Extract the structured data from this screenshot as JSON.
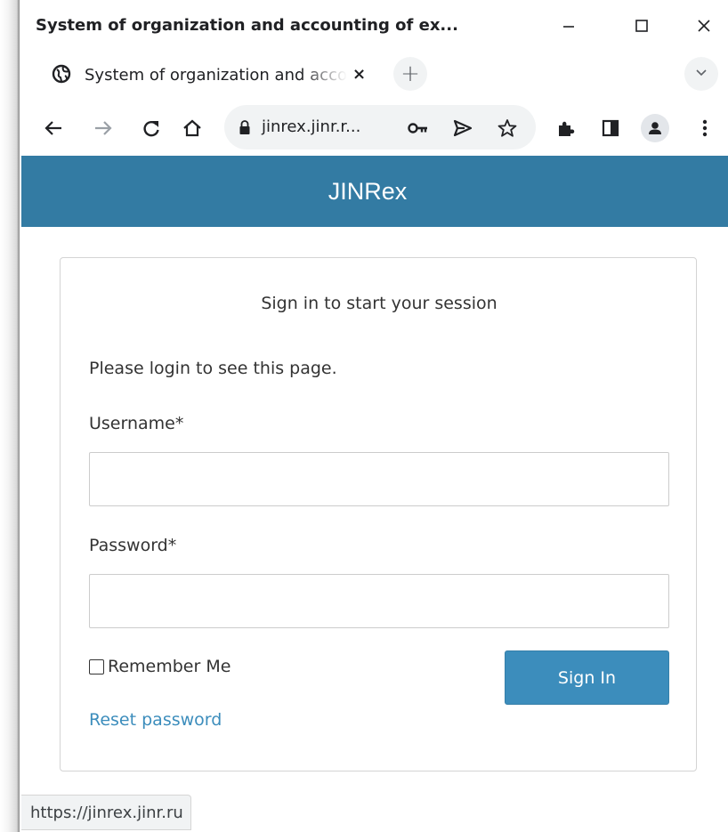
{
  "window": {
    "title": "System of organization and accounting of ex...",
    "minimize_icon": "minimize-icon",
    "maximize_icon": "maximize-icon",
    "close_icon": "close-icon"
  },
  "tab": {
    "title": "System of organization and accounting of experiments",
    "favicon": "globe-icon",
    "close_icon": "tab-close-icon",
    "close_glyph": "×"
  },
  "new_tab_glyph": "+",
  "toolbar": {
    "url": "jinrex.jinr.r...",
    "icons": [
      "back-arrow-icon",
      "forward-arrow-icon",
      "reload-icon",
      "home-icon",
      "lock-icon",
      "key-icon",
      "send-icon",
      "star-icon",
      "extensions-icon",
      "side-panel-icon",
      "profile-icon",
      "menu-icon"
    ]
  },
  "header": {
    "brand": "JINRex",
    "color": "#337ba3"
  },
  "login": {
    "box_title": "Sign in to start your session",
    "notice": "Please login to see this page.",
    "username_label": "Username*",
    "username_value": "",
    "password_label": "Password*",
    "password_value": "",
    "remember_label": "Remember Me",
    "remember_checked": false,
    "submit_label": "Sign In",
    "reset_link": "Reset password",
    "accent": "#3c8dbc"
  },
  "status_bar": {
    "url": "https://jinrex.jinr.ru"
  }
}
